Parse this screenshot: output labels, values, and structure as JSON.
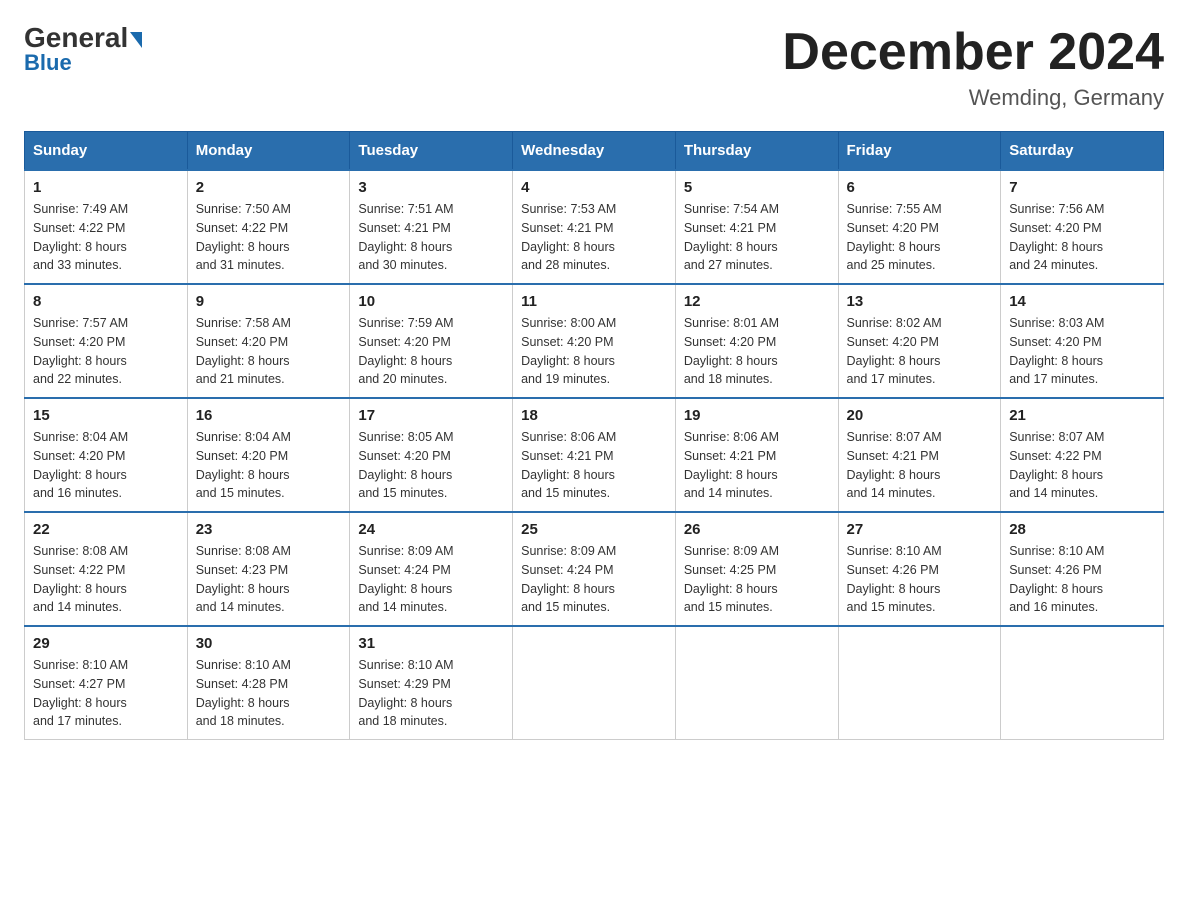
{
  "header": {
    "logo_general": "General",
    "logo_blue": "Blue",
    "month_title": "December 2024",
    "location": "Wemding, Germany"
  },
  "days_of_week": [
    "Sunday",
    "Monday",
    "Tuesday",
    "Wednesday",
    "Thursday",
    "Friday",
    "Saturday"
  ],
  "weeks": [
    [
      {
        "day": "1",
        "sunrise": "7:49 AM",
        "sunset": "4:22 PM",
        "daylight": "8 hours and 33 minutes."
      },
      {
        "day": "2",
        "sunrise": "7:50 AM",
        "sunset": "4:22 PM",
        "daylight": "8 hours and 31 minutes."
      },
      {
        "day": "3",
        "sunrise": "7:51 AM",
        "sunset": "4:21 PM",
        "daylight": "8 hours and 30 minutes."
      },
      {
        "day": "4",
        "sunrise": "7:53 AM",
        "sunset": "4:21 PM",
        "daylight": "8 hours and 28 minutes."
      },
      {
        "day": "5",
        "sunrise": "7:54 AM",
        "sunset": "4:21 PM",
        "daylight": "8 hours and 27 minutes."
      },
      {
        "day": "6",
        "sunrise": "7:55 AM",
        "sunset": "4:20 PM",
        "daylight": "8 hours and 25 minutes."
      },
      {
        "day": "7",
        "sunrise": "7:56 AM",
        "sunset": "4:20 PM",
        "daylight": "8 hours and 24 minutes."
      }
    ],
    [
      {
        "day": "8",
        "sunrise": "7:57 AM",
        "sunset": "4:20 PM",
        "daylight": "8 hours and 22 minutes."
      },
      {
        "day": "9",
        "sunrise": "7:58 AM",
        "sunset": "4:20 PM",
        "daylight": "8 hours and 21 minutes."
      },
      {
        "day": "10",
        "sunrise": "7:59 AM",
        "sunset": "4:20 PM",
        "daylight": "8 hours and 20 minutes."
      },
      {
        "day": "11",
        "sunrise": "8:00 AM",
        "sunset": "4:20 PM",
        "daylight": "8 hours and 19 minutes."
      },
      {
        "day": "12",
        "sunrise": "8:01 AM",
        "sunset": "4:20 PM",
        "daylight": "8 hours and 18 minutes."
      },
      {
        "day": "13",
        "sunrise": "8:02 AM",
        "sunset": "4:20 PM",
        "daylight": "8 hours and 17 minutes."
      },
      {
        "day": "14",
        "sunrise": "8:03 AM",
        "sunset": "4:20 PM",
        "daylight": "8 hours and 17 minutes."
      }
    ],
    [
      {
        "day": "15",
        "sunrise": "8:04 AM",
        "sunset": "4:20 PM",
        "daylight": "8 hours and 16 minutes."
      },
      {
        "day": "16",
        "sunrise": "8:04 AM",
        "sunset": "4:20 PM",
        "daylight": "8 hours and 15 minutes."
      },
      {
        "day": "17",
        "sunrise": "8:05 AM",
        "sunset": "4:20 PM",
        "daylight": "8 hours and 15 minutes."
      },
      {
        "day": "18",
        "sunrise": "8:06 AM",
        "sunset": "4:21 PM",
        "daylight": "8 hours and 15 minutes."
      },
      {
        "day": "19",
        "sunrise": "8:06 AM",
        "sunset": "4:21 PM",
        "daylight": "8 hours and 14 minutes."
      },
      {
        "day": "20",
        "sunrise": "8:07 AM",
        "sunset": "4:21 PM",
        "daylight": "8 hours and 14 minutes."
      },
      {
        "day": "21",
        "sunrise": "8:07 AM",
        "sunset": "4:22 PM",
        "daylight": "8 hours and 14 minutes."
      }
    ],
    [
      {
        "day": "22",
        "sunrise": "8:08 AM",
        "sunset": "4:22 PM",
        "daylight": "8 hours and 14 minutes."
      },
      {
        "day": "23",
        "sunrise": "8:08 AM",
        "sunset": "4:23 PM",
        "daylight": "8 hours and 14 minutes."
      },
      {
        "day": "24",
        "sunrise": "8:09 AM",
        "sunset": "4:24 PM",
        "daylight": "8 hours and 14 minutes."
      },
      {
        "day": "25",
        "sunrise": "8:09 AM",
        "sunset": "4:24 PM",
        "daylight": "8 hours and 15 minutes."
      },
      {
        "day": "26",
        "sunrise": "8:09 AM",
        "sunset": "4:25 PM",
        "daylight": "8 hours and 15 minutes."
      },
      {
        "day": "27",
        "sunrise": "8:10 AM",
        "sunset": "4:26 PM",
        "daylight": "8 hours and 15 minutes."
      },
      {
        "day": "28",
        "sunrise": "8:10 AM",
        "sunset": "4:26 PM",
        "daylight": "8 hours and 16 minutes."
      }
    ],
    [
      {
        "day": "29",
        "sunrise": "8:10 AM",
        "sunset": "4:27 PM",
        "daylight": "8 hours and 17 minutes."
      },
      {
        "day": "30",
        "sunrise": "8:10 AM",
        "sunset": "4:28 PM",
        "daylight": "8 hours and 18 minutes."
      },
      {
        "day": "31",
        "sunrise": "8:10 AM",
        "sunset": "4:29 PM",
        "daylight": "8 hours and 18 minutes."
      },
      null,
      null,
      null,
      null
    ]
  ],
  "labels": {
    "sunrise": "Sunrise:",
    "sunset": "Sunset:",
    "daylight": "Daylight:"
  }
}
